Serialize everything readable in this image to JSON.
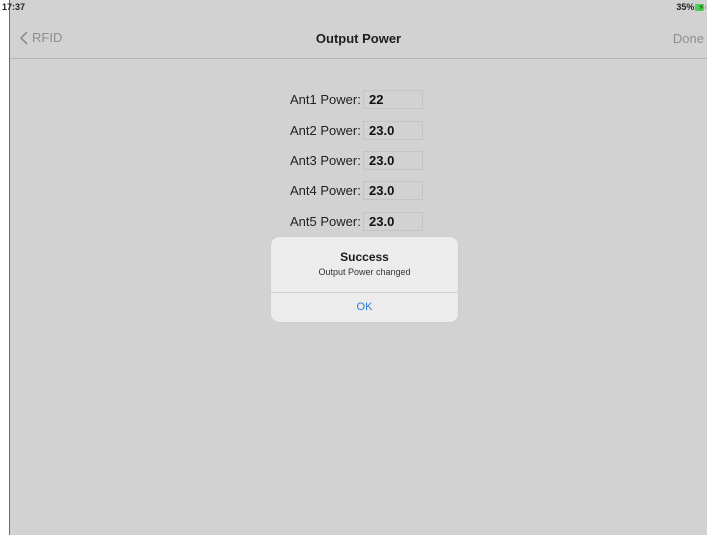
{
  "status": {
    "time": "17:37",
    "battery": "35%"
  },
  "nav": {
    "back_label": "RFID",
    "title": "Output Power",
    "done_label": "Done"
  },
  "antennas": [
    {
      "label": "Ant1 Power:",
      "value": "22"
    },
    {
      "label": "Ant2 Power:",
      "value": "23.0"
    },
    {
      "label": "Ant3 Power:",
      "value": "23.0"
    },
    {
      "label": "Ant4 Power:",
      "value": "23.0"
    },
    {
      "label": "Ant5 Power:",
      "value": "23.0"
    }
  ],
  "alert": {
    "title": "Success",
    "message": "Output Power changed",
    "ok_label": "OK"
  },
  "colors": {
    "background": "#d2d2d2",
    "accent": "#2d7ad6",
    "battery": "#4bd14b"
  },
  "icons": [
    "chevron-left-icon",
    "battery-icon"
  ]
}
